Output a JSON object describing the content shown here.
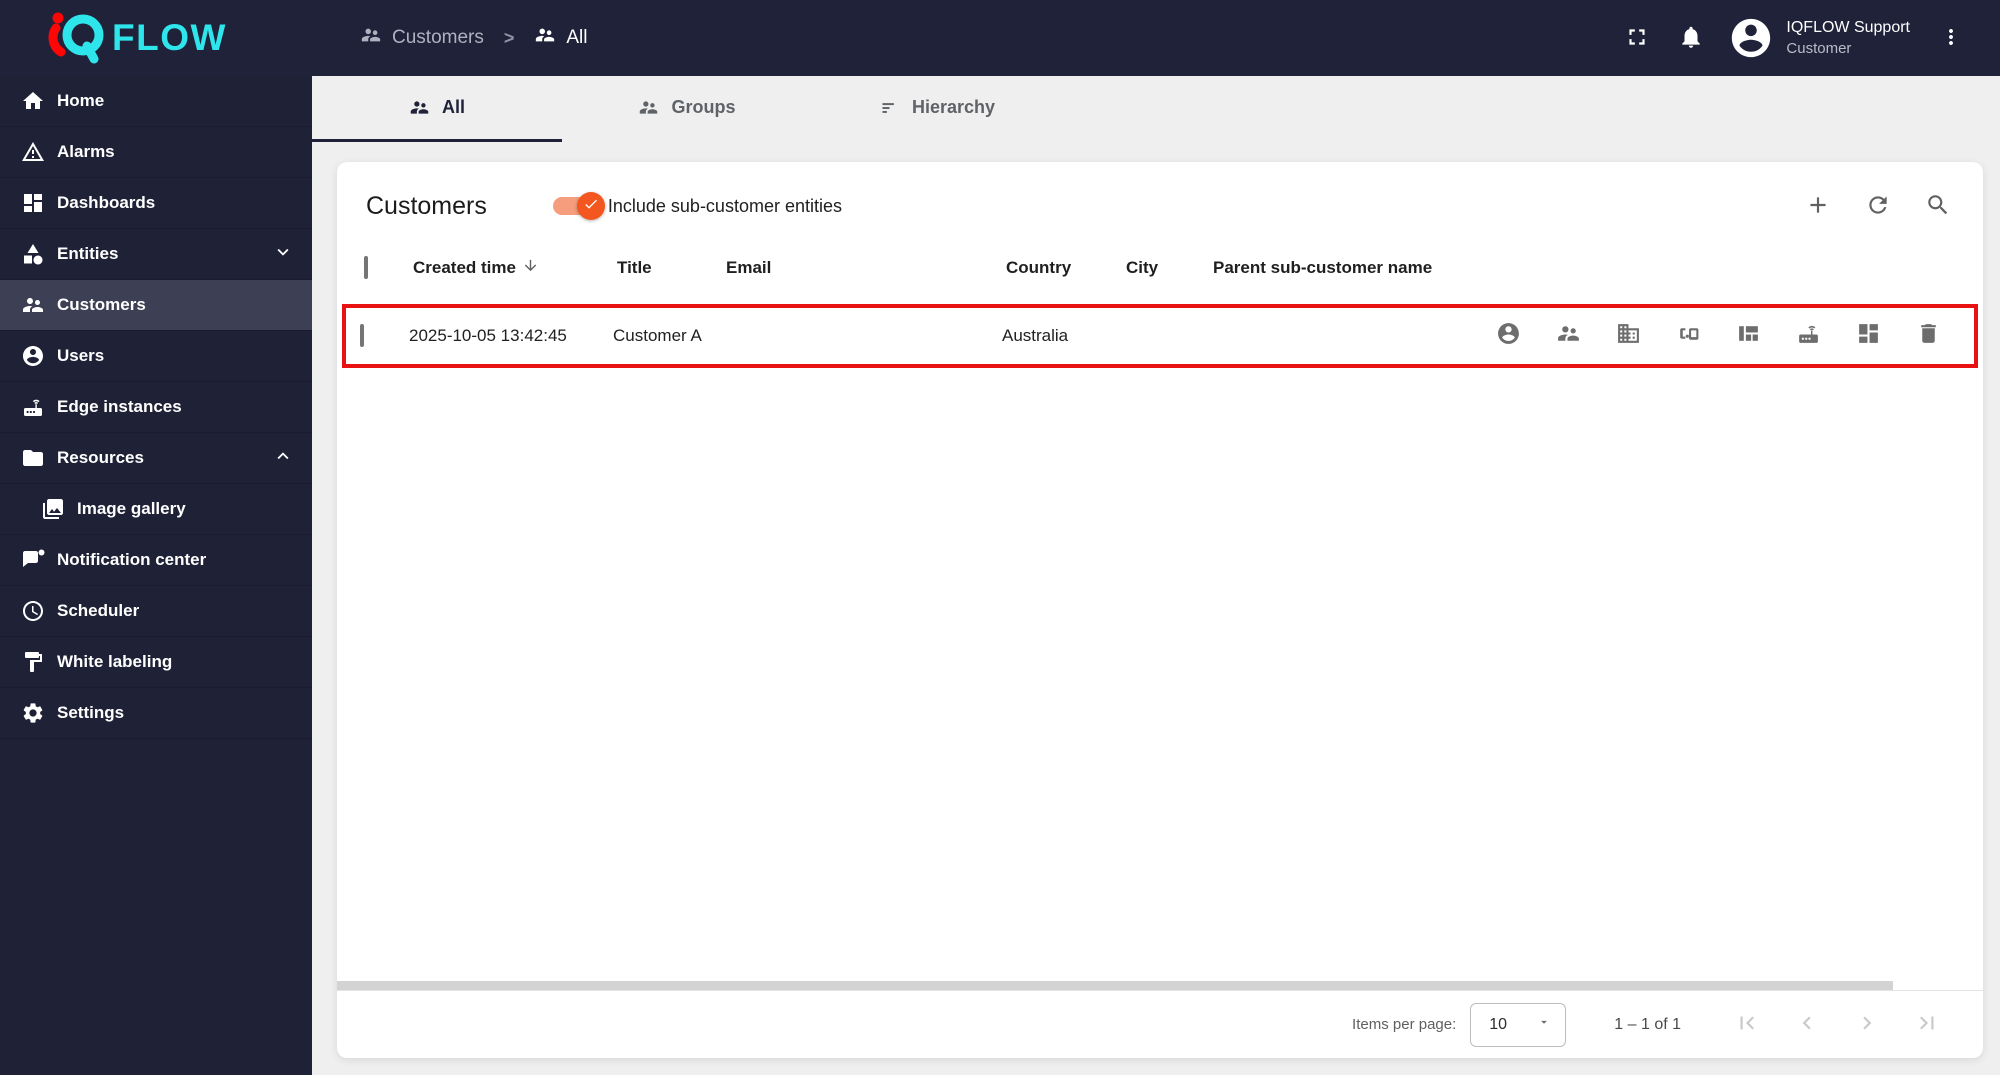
{
  "topbar": {
    "logo_flow_text": "FLOW",
    "breadcrumb": {
      "items": [
        "Customers",
        "All"
      ],
      "separator": ">"
    },
    "user_name": "IQFLOW Support",
    "user_role": "Customer"
  },
  "sidebar": {
    "items": [
      {
        "label": "Home",
        "icon": "home-icon"
      },
      {
        "label": "Alarms",
        "icon": "alarm-warning-icon"
      },
      {
        "label": "Dashboards",
        "icon": "dashboards-icon"
      },
      {
        "label": "Entities",
        "icon": "entities-category-icon",
        "chevron": "down"
      },
      {
        "label": "Customers",
        "icon": "customers-people-icon",
        "selected": true
      },
      {
        "label": "Users",
        "icon": "user-circle-icon"
      },
      {
        "label": "Edge instances",
        "icon": "edge-router-icon"
      },
      {
        "label": "Resources",
        "icon": "folder-icon",
        "chevron": "up"
      },
      {
        "label": "Image gallery",
        "icon": "image-gallery-icon",
        "sub_item": true
      },
      {
        "label": "Notification center",
        "icon": "notification-message-icon"
      },
      {
        "label": "Scheduler",
        "icon": "clock-icon"
      },
      {
        "label": "White labeling",
        "icon": "paint-roller-icon"
      },
      {
        "label": "Settings",
        "icon": "gear-icon"
      }
    ]
  },
  "tabs": [
    {
      "label": "All",
      "icon": "people-icon",
      "active": true
    },
    {
      "label": "Groups",
      "icon": "people-icon",
      "active": false
    },
    {
      "label": "Hierarchy",
      "icon": "sort-lines-icon",
      "active": false
    }
  ],
  "panel": {
    "title": "Customers",
    "toggle_label": "Include sub-customer entities",
    "toggle_on": true
  },
  "table": {
    "columns": [
      "Created time",
      "Title",
      "Email",
      "Country",
      "City",
      "Parent sub-customer name"
    ],
    "sort_column": "Created time",
    "sort_direction": "desc",
    "rows": [
      {
        "created_time": "2025-10-05 13:42:45",
        "title": "Customer A",
        "email": "",
        "country": "Australia",
        "city": "",
        "parent_sub_customer_name": ""
      }
    ],
    "row_actions": [
      "manage-users",
      "manage-customers",
      "manage-assets",
      "manage-devices",
      "manage-dashboards",
      "manage-edge-instances",
      "manage-dashboard-groups",
      "delete"
    ]
  },
  "footer": {
    "items_per_page_label": "Items per page:",
    "page_size": "10",
    "range_label": "1 – 1 of 1"
  },
  "colors": {
    "topbar_bg": "#1f2239",
    "sidebar_selected_bg": "#3d3f54",
    "logo_cyan": "#2fe5ec",
    "logo_red": "#ff0606",
    "toggle_orange": "#f4561f",
    "annotation_red": "#e81212"
  }
}
